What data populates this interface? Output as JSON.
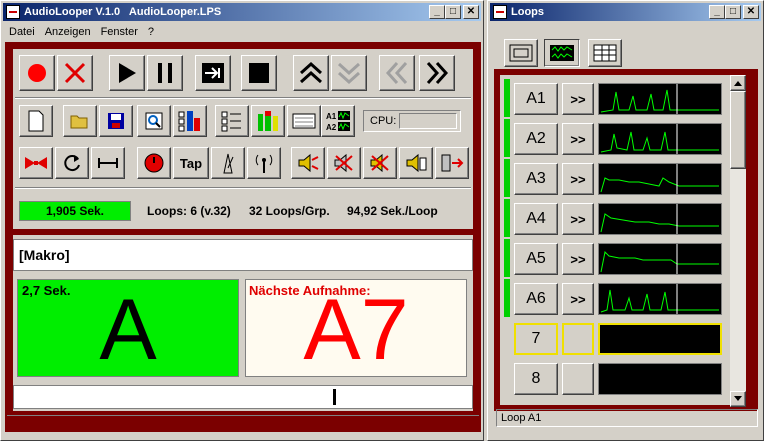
{
  "main_window": {
    "title": "AudioLooper V.1.0   AudioLooper.LPS",
    "menu": [
      "Datei",
      "Anzeigen",
      "Fenster",
      "?"
    ]
  },
  "toolbar": {
    "tap_label": "Tap",
    "cpu_label": "CPU:"
  },
  "status": {
    "time": "1,905 Sek.",
    "loops": "Loops: 6 (v.32)",
    "loops_per_group": "32 Loops/Grp.",
    "sec_per_loop": "94,92 Sek./Loop"
  },
  "macro": {
    "label": "[Makro]"
  },
  "current": {
    "time": "2,7 Sek.",
    "letter": "A"
  },
  "next": {
    "caption": "Nächste Aufnahme:",
    "name": "A7"
  },
  "loops_window": {
    "title": "Loops",
    "status": "Loop A1",
    "forward_label": ">>",
    "rows": [
      {
        "name": "A1",
        "active": true
      },
      {
        "name": "A2",
        "active": true
      },
      {
        "name": "A3",
        "active": true
      },
      {
        "name": "A4",
        "active": true
      },
      {
        "name": "A5",
        "active": true
      },
      {
        "name": "A6",
        "active": true
      },
      {
        "name": "7",
        "active": false
      },
      {
        "name": "8",
        "active": false
      }
    ]
  },
  "colors": {
    "accent": "#7b0000",
    "green": "#00ff00",
    "red": "#ff0000"
  }
}
